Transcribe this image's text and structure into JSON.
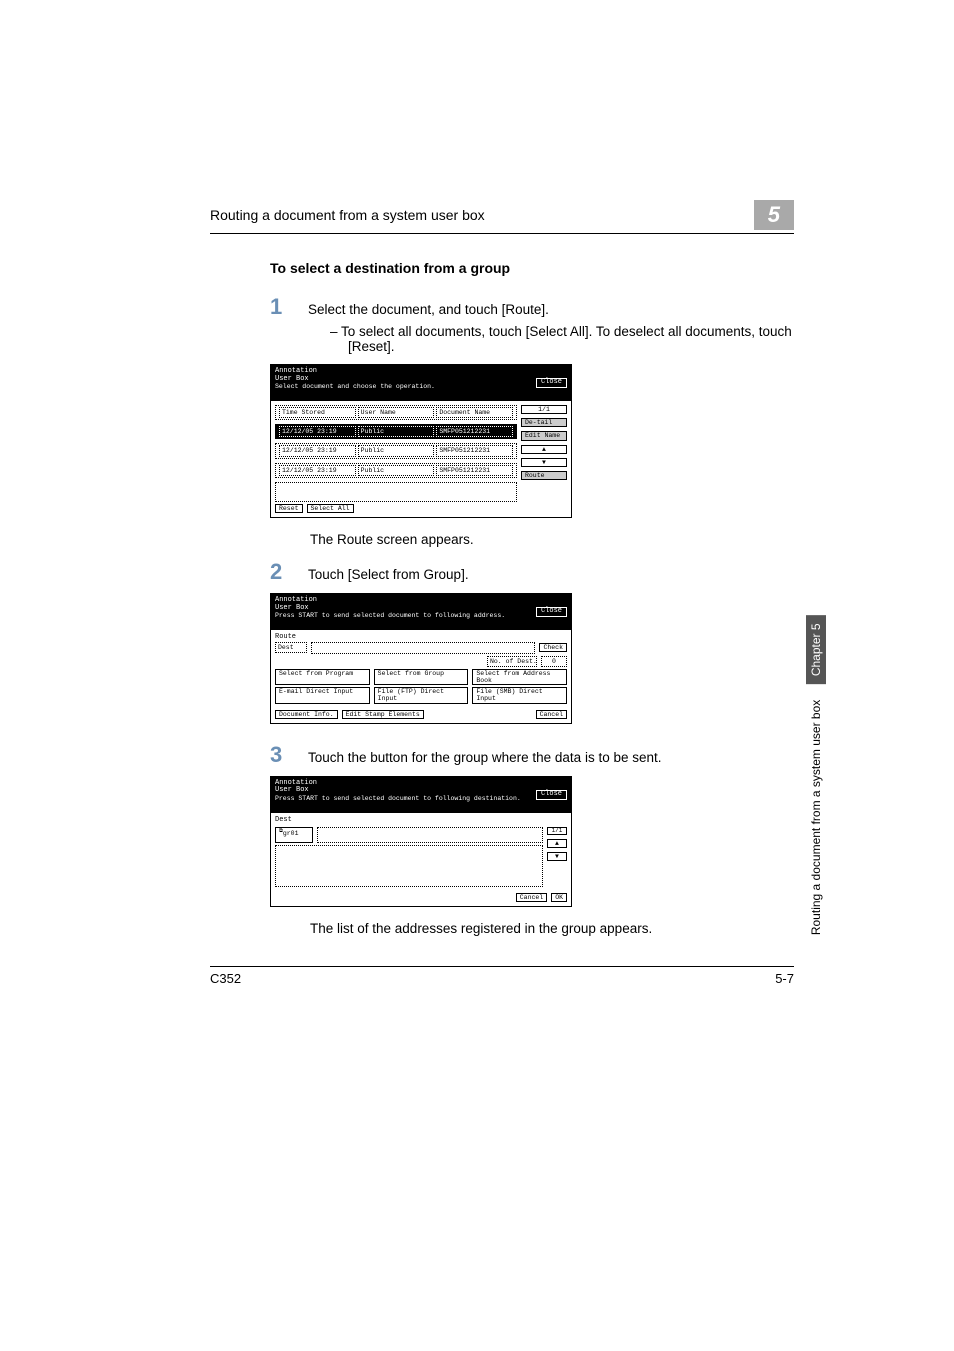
{
  "header": {
    "title": "Routing a document from a system user box",
    "chapter_num": "5"
  },
  "sub_heading": "To select a destination from a group",
  "steps": {
    "s1": {
      "num": "1",
      "text": "Select the document, and touch [Route].",
      "bullet": "–   To select all documents, touch [Select All]. To deselect all documents, touch [Reset]."
    },
    "after1": "The Route screen appears.",
    "s2": {
      "num": "2",
      "text": "Touch [Select from Group]."
    },
    "s3": {
      "num": "3",
      "text": "Touch the button for the group where the data is to be sent."
    },
    "after3": "The list of the addresses registered in the group appears."
  },
  "scr1": {
    "title": "Annotation\nUser Box",
    "subtitle": "Select document and choose the operation.",
    "close": "Close",
    "cols": {
      "time": "Time Stored",
      "user": "User Name",
      "doc": "Document Name"
    },
    "rows": [
      {
        "time": "12/12/05 23:19",
        "user": "Public",
        "doc": "SMFP051212231"
      },
      {
        "time": "12/12/05 23:19",
        "user": "Public",
        "doc": "SMFP051212231"
      },
      {
        "time": "12/12/05 23:19",
        "user": "Public",
        "doc": "SMFP051212231"
      }
    ],
    "reset": "Reset",
    "select_all": "Select All",
    "side": {
      "detail": "De-tail",
      "edit": "Edit Name",
      "route": "Route"
    }
  },
  "scr2": {
    "title": "Annotation\nUser Box",
    "subtitle": "Press START to send selected document to following address.",
    "close": "Close",
    "route": "Route",
    "dest": "Dest",
    "check": "Check",
    "no_of_dest": "No. of Dest.",
    "zero": "0",
    "btns": {
      "prog": "Select from Program",
      "group": "Select from Group",
      "addr": "Select from Address Book",
      "email": "E-mail Direct Input",
      "ftp": "File (FTP) Direct Input",
      "smb": "File (SMB) Direct Input",
      "docinfo": "Document Info.",
      "stamp": "Edit Stamp Elements"
    },
    "cancel": "Cancel"
  },
  "scr3": {
    "title": "Annotation\nUser Box",
    "subtitle": "Press START to send selected document to following destination.",
    "close": "Close",
    "dest": "Dest",
    "gr": "gr01",
    "page": "1/1",
    "cancel": "Cancel",
    "ok": "OK"
  },
  "side_tab": {
    "dark": "Chapter 5",
    "light": "Routing a document from a system user box"
  },
  "footer": {
    "left": "C352",
    "right": "5-7"
  }
}
